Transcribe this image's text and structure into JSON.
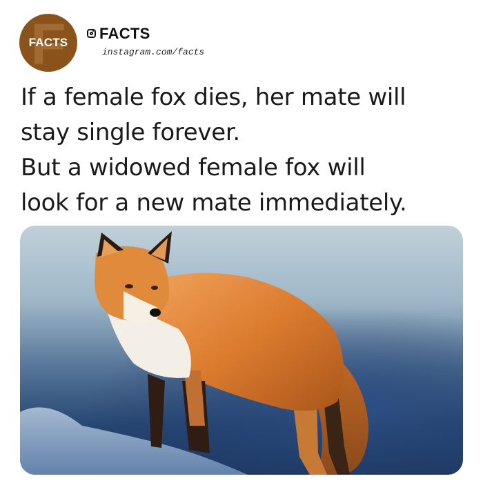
{
  "profile": {
    "avatar_letter": "F",
    "avatar_label": "FACTS",
    "account_name": "FACTS",
    "account_url": "instagram.com/facts",
    "platform_icon": "instagram-icon"
  },
  "post": {
    "lines": [
      "If a female fox dies, her mate will",
      "stay single forever.",
      "But a widowed female fox will",
      "look for a new mate immediately."
    ]
  },
  "photo": {
    "subject": "fox-photo"
  },
  "colors": {
    "avatar_bg": "#8a531b",
    "text": "#1a1a1a",
    "fox_orange": "#d9782a"
  }
}
